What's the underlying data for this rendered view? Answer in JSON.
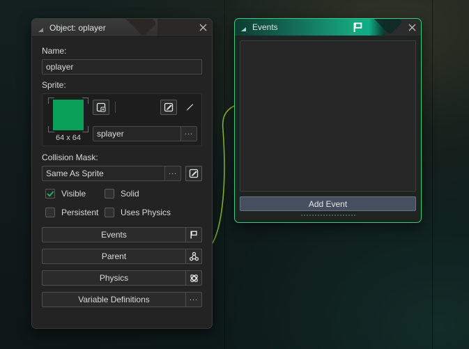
{
  "object_panel": {
    "title": "Object: oplayer",
    "collapse_icon": "collapse-triangle-icon",
    "close_icon": "close-icon",
    "name_label": "Name:",
    "name_value": "oplayer",
    "sprite_label": "Sprite:",
    "sprite_thumb_size": "64 x 64",
    "sprite_color": "#0ba05a",
    "sprite_name": "splayer",
    "sprite_browse_label": "...",
    "sprite_new_icon": "new-sprite-icon",
    "sprite_edit_icon": "edit-sprite-icon",
    "sprite_paint_icon": "paintbrush-icon",
    "collision_label": "Collision Mask:",
    "collision_value": "Same As Sprite",
    "collision_browse_label": "...",
    "collision_edit_icon": "edit-mask-icon",
    "checkboxes": [
      {
        "label": "Visible",
        "checked": true
      },
      {
        "label": "Solid",
        "checked": false
      },
      {
        "label": "Persistent",
        "checked": false
      },
      {
        "label": "Uses Physics",
        "checked": false
      }
    ],
    "actions": [
      {
        "label": "Events",
        "icon": "flag-icon"
      },
      {
        "label": "Parent",
        "icon": "parent-nodes-icon"
      },
      {
        "label": "Physics",
        "icon": "physics-atom-icon"
      },
      {
        "label": "Variable Definitions",
        "icon": "ellipsis-icon",
        "icon_text": "..."
      }
    ]
  },
  "events_panel": {
    "title": "Events",
    "collapse_icon": "collapse-triangle-icon",
    "flag_icon": "flag-icon",
    "close_icon": "close-icon",
    "list_items": [],
    "add_event_label": "Add Event",
    "accent_color": "#31d07e"
  }
}
